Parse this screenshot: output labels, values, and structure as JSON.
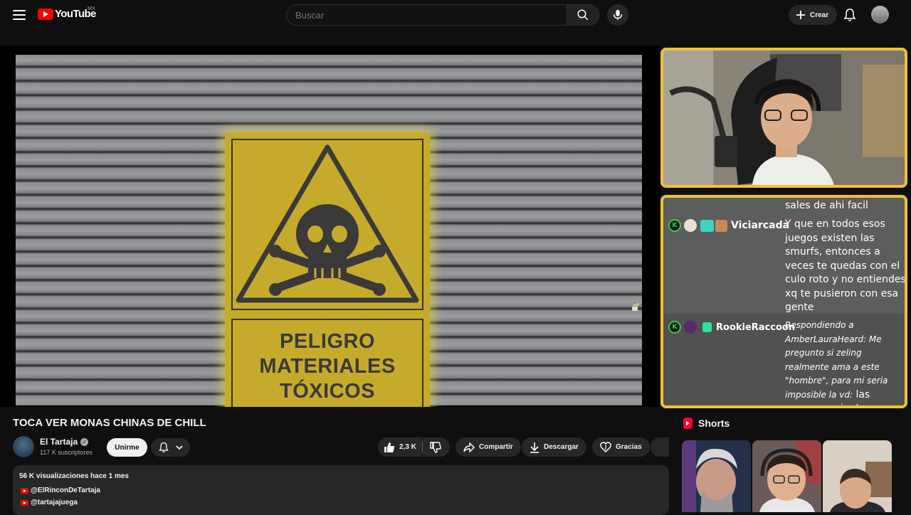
{
  "header": {
    "logo_text": "YouTube",
    "country": "MX",
    "search_placeholder": "Buscar",
    "create_label": "Crear"
  },
  "video": {
    "sign_lines": [
      "PELIGRO",
      "MATERIALES",
      "TÓXICOS"
    ],
    "title": "TOCA VER MONAS CHINAS DE CHILL"
  },
  "channel": {
    "name": "El Tartaja",
    "subscribers": "117 K suscriptores",
    "join_label": "Unirme"
  },
  "actions": {
    "likes": "2,3 K",
    "share_label": "Compartir",
    "download_label": "Descargar",
    "thanks_label": "Gracias"
  },
  "description": {
    "meta": "56 K visualizaciones  hace 1 mes",
    "links": [
      "@ElRinconDeTartaja",
      "@tartajajuega"
    ]
  },
  "chat": {
    "messages": [
      {
        "user": "",
        "text": "sales de ahi facil"
      },
      {
        "user": "Viciarcada",
        "text": "Y que en todos esos juegos existen las smurfs, entonces a veces te quedas con el culo roto y no entiendes xq te pusieron con esa gente"
      },
      {
        "user": "RookieRaccoon",
        "reply": "Respondiendo a AmberLauraHeard: Me pregunto si zeling realmente ama a este \"hombre\", para mi seria imposible la vd:",
        "text": "las moscas se juntan con la mrda we xd"
      }
    ],
    "badge_letter": "K"
  },
  "shorts": {
    "label": "Shorts"
  },
  "colors": {
    "background": "#0f0f0f",
    "brand_red": "#ff0000",
    "overlay_border": "#f0c137",
    "chat_bg": "#5c5e5b",
    "sign_yellow": "#c6aa2b"
  }
}
